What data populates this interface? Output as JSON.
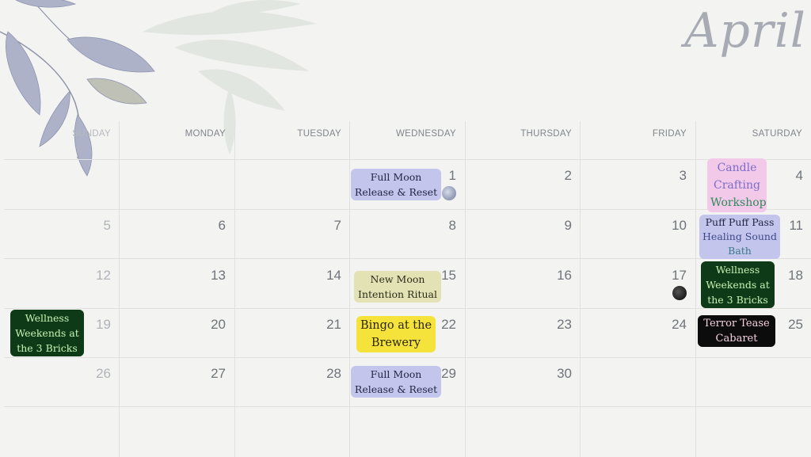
{
  "month": "April",
  "weekdays": [
    "SUNDAY",
    "MONDAY",
    "TUESDAY",
    "WEDNESDAY",
    "THURSDAY",
    "FRIDAY",
    "SATURDAY"
  ],
  "dates": {
    "d1": "1",
    "d2": "2",
    "d3": "3",
    "d4": "4",
    "d5": "5",
    "d6": "6",
    "d7": "7",
    "d8": "8",
    "d9": "9",
    "d10": "10",
    "d11": "11",
    "d12": "12",
    "d13": "13",
    "d14": "14",
    "d15": "15",
    "d16": "16",
    "d17": "17",
    "d18": "18",
    "d19": "19",
    "d20": "20",
    "d21": "21",
    "d22": "22",
    "d23": "23",
    "d24": "24",
    "d25": "25",
    "d26": "26",
    "d27": "27",
    "d28": "28",
    "d29": "29",
    "d30": "30"
  },
  "events": {
    "full_moon_1_line1": "Full Moon",
    "full_moon_1_line2": "Release & Reset",
    "candle_line1": "Candle",
    "candle_line2": "Crafting",
    "candle_line3": "Workshop",
    "puff_line1": "Puff Puff Pass",
    "puff_line2": "Healing Sound",
    "puff_line3": "Bath",
    "new_moon_line1": "New Moon",
    "new_moon_line2": "Intention Ritual",
    "wellness_18_line1": "Wellness",
    "wellness_18_line2": "Weekends at",
    "wellness_18_line3": "the 3 Bricks",
    "wellness_19_line1": "Wellness",
    "wellness_19_line2": "Weekends at",
    "wellness_19_line3": "the 3 Bricks",
    "bingo_line1": "Bingo at the",
    "bingo_line2": "Brewery",
    "terror_line1": "Terror  Tease",
    "terror_line2": "Cabaret",
    "full_moon_29_line1": "Full Moon",
    "full_moon_29_line2": "Release & Reset"
  },
  "colors": {
    "lavender": "#c3c5ec",
    "pink": "#f2c9e8",
    "khaki": "#e3e2b4",
    "yellow": "#f5e23a",
    "green": "#0f3a17",
    "black": "#0c0c0c"
  }
}
